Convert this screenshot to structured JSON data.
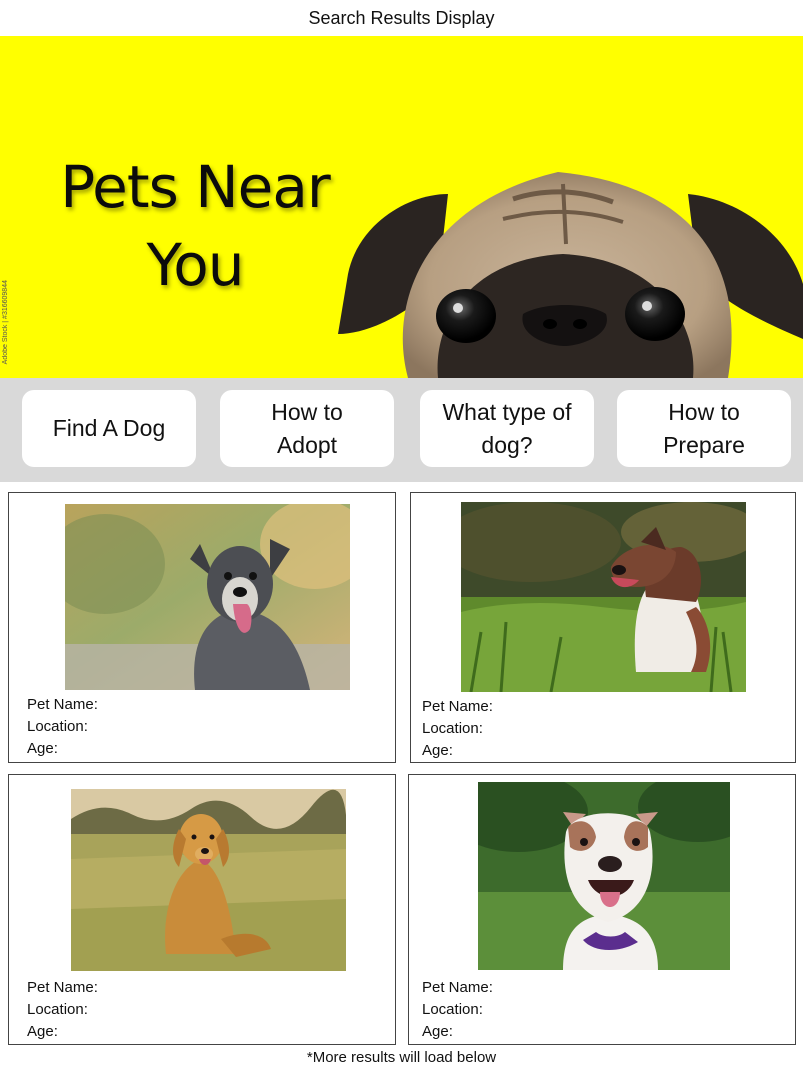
{
  "header": {
    "title": "Search Results Display"
  },
  "hero": {
    "title_line1": "Pets Near",
    "title_line2": "You",
    "credit": "Adobe Stock | #316609844",
    "background": "#ffff00"
  },
  "nav": {
    "items": [
      {
        "label": "Find A Dog"
      },
      {
        "label": "How to\nAdopt"
      },
      {
        "label": "What type of\ndog?"
      },
      {
        "label": "How to\nPrepare"
      }
    ]
  },
  "results": {
    "cards": [
      {
        "photo": "gray-dog-photo",
        "name_label": "Pet Name:",
        "location_label": "Location:",
        "age_label": "Age:"
      },
      {
        "photo": "australian-shepherd-photo",
        "name_label": "Pet Name:",
        "location_label": "Location:",
        "age_label": "Age:"
      },
      {
        "photo": "golden-retriever-photo",
        "name_label": "Pet Name:",
        "location_label": "Location:",
        "age_label": "Age:"
      },
      {
        "photo": "pitbull-photo",
        "name_label": "Pet Name:",
        "location_label": "Location:",
        "age_label": "Age:"
      }
    ]
  },
  "footer": {
    "note": "*More results will load below"
  }
}
